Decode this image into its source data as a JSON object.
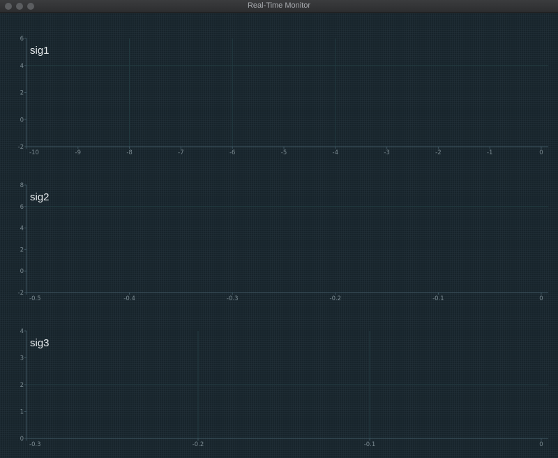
{
  "window": {
    "title": "Real-Time Monitor",
    "buttons": [
      "close",
      "minimize",
      "maximize"
    ]
  },
  "chart_data": [
    {
      "type": "line",
      "title": "sig1",
      "xlim": [
        -10,
        0
      ],
      "ylim": [
        -2,
        6
      ],
      "xticks": [
        -10,
        -9,
        -8,
        -7,
        -6,
        -5,
        -4,
        -3,
        -2,
        -1,
        0
      ],
      "yticks": [
        -2,
        0,
        2,
        4,
        6
      ],
      "xgrid": [
        -8,
        -6,
        -4
      ],
      "ygrid": [
        4
      ],
      "series": []
    },
    {
      "type": "line",
      "title": "sig2",
      "xlim": [
        -0.5,
        0
      ],
      "ylim": [
        -2,
        8
      ],
      "xticks": [
        -0.5,
        -0.4,
        -0.3,
        -0.2,
        -0.1,
        0
      ],
      "yticks": [
        -2,
        0,
        2,
        4,
        6,
        8
      ],
      "xgrid": [],
      "ygrid": [
        6
      ],
      "series": []
    },
    {
      "type": "line",
      "title": "sig3",
      "xlim": [
        -0.3,
        0
      ],
      "ylim": [
        0,
        4
      ],
      "xticks": [
        -0.3,
        -0.2,
        -0.1,
        0
      ],
      "yticks": [
        0,
        1,
        2,
        3,
        4
      ],
      "xgrid": [
        -0.2,
        -0.1
      ],
      "ygrid": [
        2
      ],
      "series": []
    }
  ]
}
